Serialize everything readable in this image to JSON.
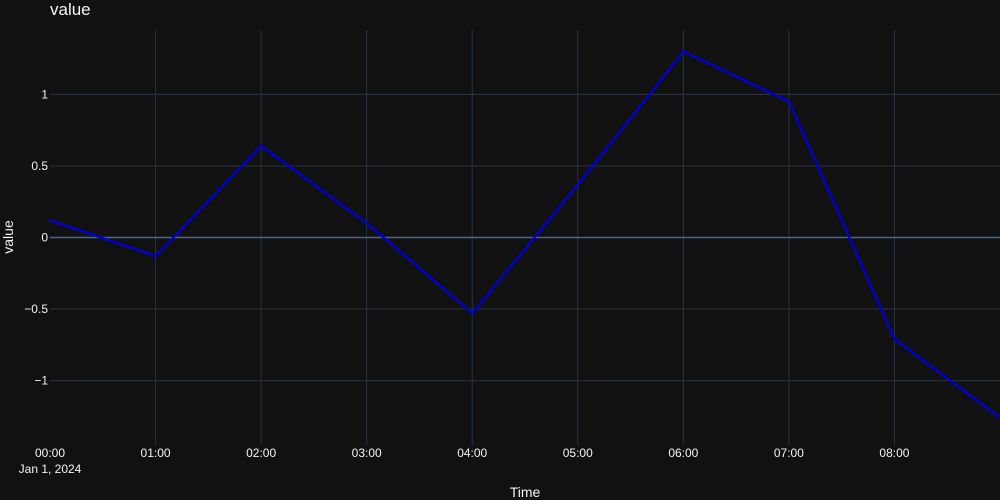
{
  "chart_data": {
    "type": "line",
    "title": "value",
    "xlabel": "Time",
    "ylabel": "value",
    "x_start_label": "Jan 1, 2024",
    "x": [
      "2024-01-01 00:00",
      "2024-01-01 01:00",
      "2024-01-01 02:00",
      "2024-01-01 03:00",
      "2024-01-01 04:00",
      "2024-01-01 05:00",
      "2024-01-01 06:00",
      "2024-01-01 07:00",
      "2024-01-01 08:00",
      "2024-01-01 09:00"
    ],
    "x_tick_labels": [
      "00:00",
      "01:00",
      "02:00",
      "03:00",
      "04:00",
      "05:00",
      "06:00",
      "07:00",
      "08:00"
    ],
    "series": [
      {
        "name": "",
        "color": "#0000cc",
        "values": [
          0.12,
          -0.13,
          0.64,
          0.1,
          -0.53,
          0.37,
          1.3,
          0.95,
          -0.71,
          -1.26
        ]
      }
    ],
    "yticks": [
      -1,
      -0.5,
      0,
      0.5,
      1
    ],
    "ytick_labels": [
      "−1",
      "−0.5",
      "0",
      "0.5",
      "1"
    ],
    "ylim": [
      -1.45,
      1.45
    ],
    "xlim": [
      "2024-01-01 00:00",
      "2024-01-01 09:00"
    ],
    "grid": true,
    "legend": "none",
    "colors": {
      "background": "#111111",
      "grid": "#283442",
      "zeroline": "#506784",
      "text": "#f2f5fa",
      "line": "#0000cc"
    }
  }
}
